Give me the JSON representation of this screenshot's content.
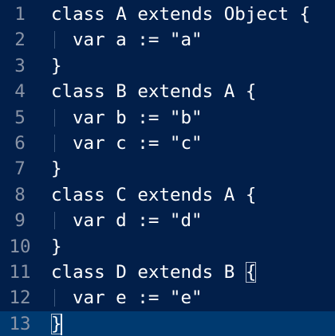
{
  "editor": {
    "lines": [
      {
        "number": "1",
        "text": "class A extends Object {"
      },
      {
        "number": "2",
        "text": "var a := \"a\""
      },
      {
        "number": "3",
        "text": "}"
      },
      {
        "number": "4",
        "text": "class B extends A {"
      },
      {
        "number": "5",
        "text": "var b := \"b\""
      },
      {
        "number": "6",
        "text": "var c := \"c\""
      },
      {
        "number": "7",
        "text": "}"
      },
      {
        "number": "8",
        "text": "class C extends A {"
      },
      {
        "number": "9",
        "text": "var d := \"d\""
      },
      {
        "number": "10",
        "text": "}"
      },
      {
        "number": "11",
        "text": "class D extends B "
      },
      {
        "number": "12",
        "text": "var e := \"e\""
      },
      {
        "number": "13",
        "text": "}"
      }
    ],
    "matched_bracket": "{",
    "current_line": "13",
    "colors": {
      "background": "#021f4a",
      "current_line": "#003a70",
      "line_number": "#8a94a6",
      "text": "#ffffff"
    }
  }
}
